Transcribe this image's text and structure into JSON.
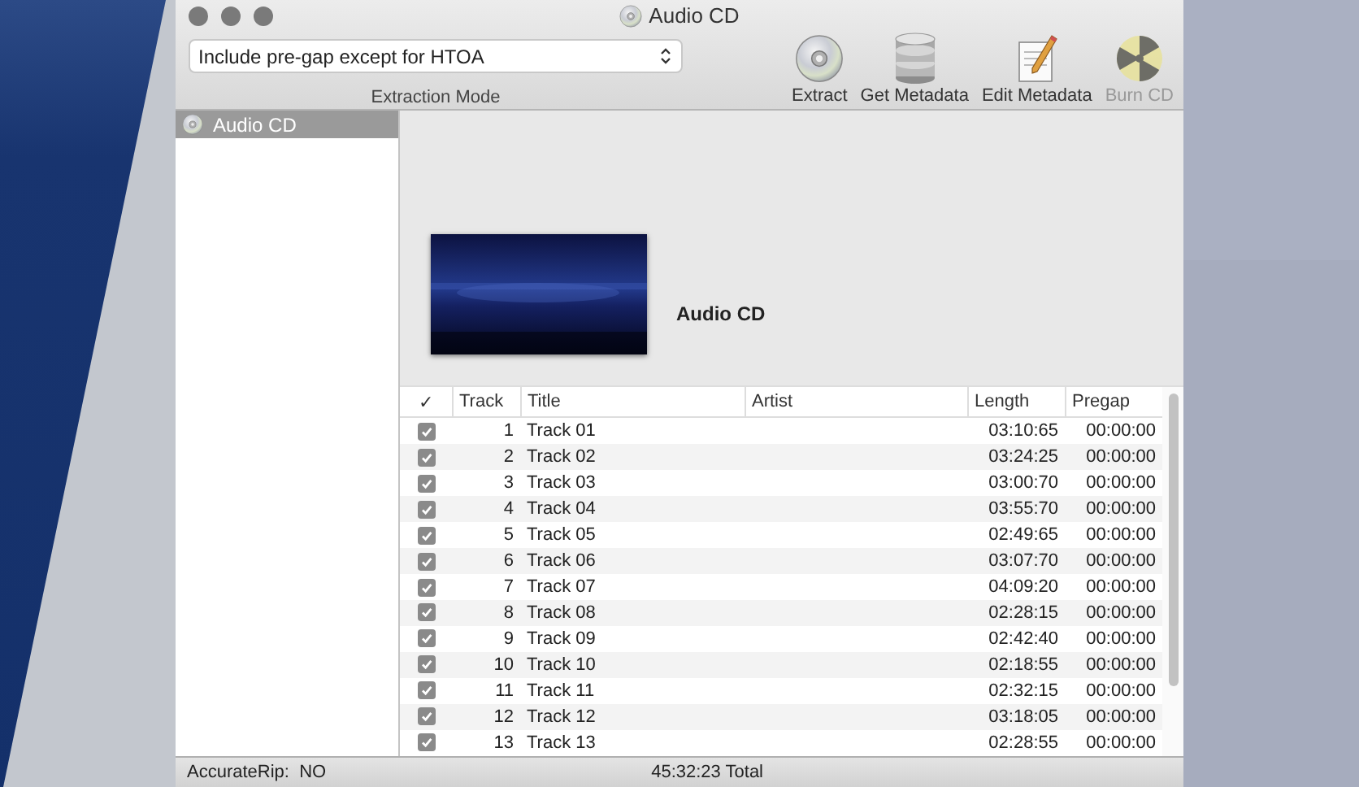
{
  "window": {
    "title": "Audio CD"
  },
  "toolbar": {
    "extraction_mode": {
      "value": "Include pre-gap except for HTOA",
      "label": "Extraction Mode"
    },
    "buttons": [
      {
        "label": "Extract",
        "kind": "disc",
        "disabled": false
      },
      {
        "label": "Get Metadata",
        "kind": "database",
        "disabled": false
      },
      {
        "label": "Edit Metadata",
        "kind": "notepad",
        "disabled": false
      },
      {
        "label": "Burn CD",
        "kind": "burn",
        "disabled": true
      }
    ]
  },
  "sidebar": {
    "items": [
      {
        "label": "Audio CD",
        "selected": true
      }
    ]
  },
  "album": {
    "title": "Audio CD"
  },
  "table": {
    "columns": [
      "✓",
      "Track",
      "Title",
      "Artist",
      "Length",
      "Pregap"
    ],
    "rows": [
      {
        "checked": true,
        "track": "1",
        "title": "Track 01",
        "length": "03:10:65",
        "pregap": "00:00:00"
      },
      {
        "checked": true,
        "track": "2",
        "title": "Track 02",
        "length": "03:24:25",
        "pregap": "00:00:00"
      },
      {
        "checked": true,
        "track": "3",
        "title": "Track 03",
        "length": "03:00:70",
        "pregap": "00:00:00"
      },
      {
        "checked": true,
        "track": "4",
        "title": "Track 04",
        "length": "03:55:70",
        "pregap": "00:00:00"
      },
      {
        "checked": true,
        "track": "5",
        "title": "Track 05",
        "length": "02:49:65",
        "pregap": "00:00:00"
      },
      {
        "checked": true,
        "track": "6",
        "title": "Track 06",
        "length": "03:07:70",
        "pregap": "00:00:00"
      },
      {
        "checked": true,
        "track": "7",
        "title": "Track 07",
        "length": "04:09:20",
        "pregap": "00:00:00"
      },
      {
        "checked": true,
        "track": "8",
        "title": "Track 08",
        "length": "02:28:15",
        "pregap": "00:00:00"
      },
      {
        "checked": true,
        "track": "9",
        "title": "Track 09",
        "length": "02:42:40",
        "pregap": "00:00:00"
      },
      {
        "checked": true,
        "track": "10",
        "title": "Track 10",
        "length": "02:18:55",
        "pregap": "00:00:00"
      },
      {
        "checked": true,
        "track": "11",
        "title": "Track 11",
        "length": "02:32:15",
        "pregap": "00:00:00"
      },
      {
        "checked": true,
        "track": "12",
        "title": "Track 12",
        "length": "03:18:05",
        "pregap": "00:00:00"
      },
      {
        "checked": true,
        "track": "13",
        "title": "Track 13",
        "length": "02:28:55",
        "pregap": "00:00:00"
      }
    ]
  },
  "status_bar": {
    "accuraterip": "AccurateRip:  NO",
    "total": "45:32:23 Total"
  }
}
